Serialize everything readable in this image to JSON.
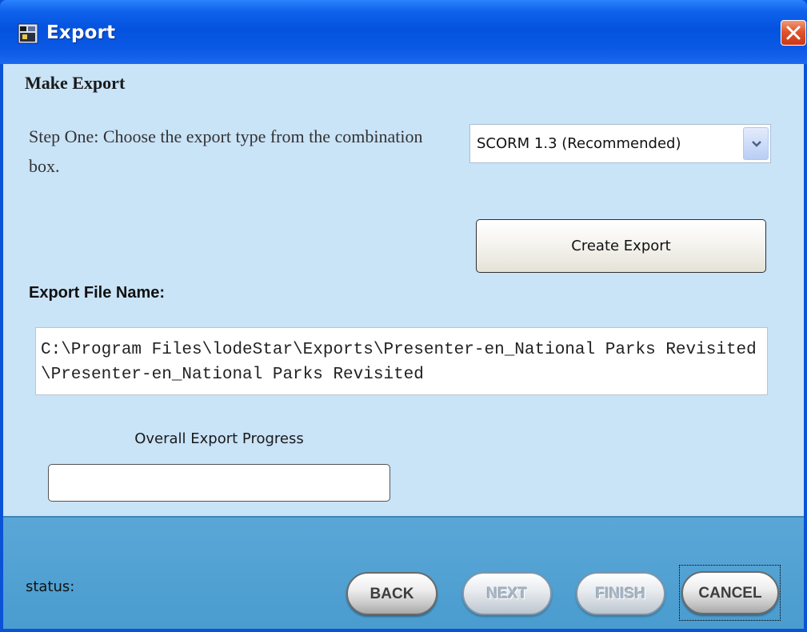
{
  "window": {
    "title": "Export",
    "close_icon": "close-icon",
    "app_icon": "export-app-icon"
  },
  "main": {
    "heading": "Make Export",
    "step_one_text": "Step One:  Choose the export type from the combination box.",
    "export_type": {
      "selected": "SCORM 1.3 (Recommended)",
      "icon": "chevron-down-icon"
    },
    "create_export_label": "Create Export",
    "filename_label": "Export File Name:",
    "filename_value": "C:\\Program Files\\lodeStar\\Exports\\Presenter-en_National Parks Revisited\\Presenter-en_National Parks Revisited",
    "progress": {
      "label": "Overall Export Progress",
      "value": 0
    }
  },
  "footer": {
    "status_label": "status:",
    "buttons": {
      "back": "BACK",
      "next": "NEXT",
      "finish": "FINISH",
      "cancel": "CANCEL"
    }
  },
  "colors": {
    "titlebar": "#0453e0",
    "client": "#c9e3f7",
    "footer": "#4a9ccf",
    "close": "#e0542b"
  }
}
